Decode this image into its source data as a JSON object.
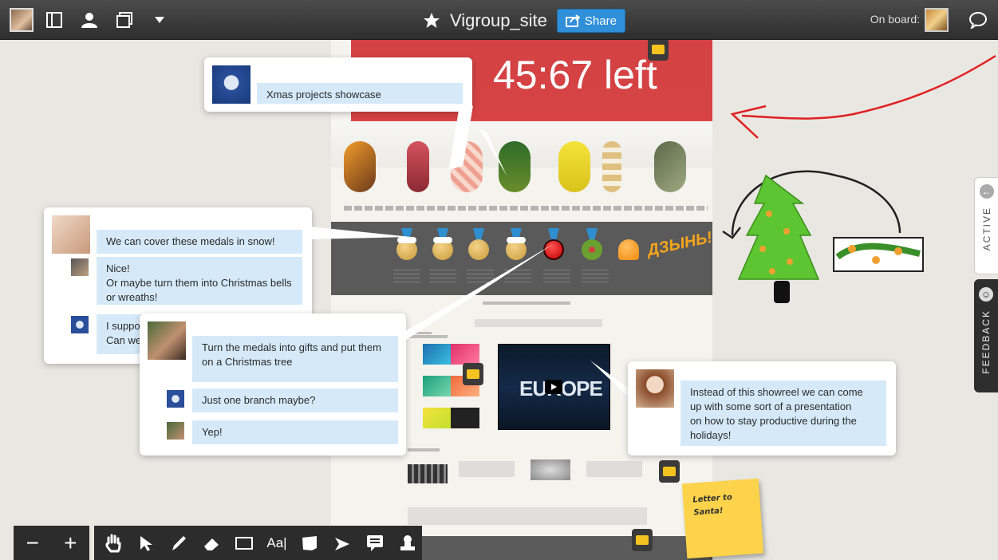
{
  "topbar": {
    "board_title": "Vigroup_site",
    "share_label": "Share",
    "on_board_label": "On board:"
  },
  "board": {
    "timer_text": "45:67 left",
    "sticky_note": "Letter to Santa!",
    "doodle_text": "ДЗЫНЬ!"
  },
  "site": {
    "video_title": "EUROPE"
  },
  "threads": [
    {
      "messages": [
        {
          "text": "Xmas projects showcase"
        }
      ]
    },
    {
      "messages": [
        {
          "text": "We can cover these medals in snow!"
        },
        {
          "text": "Nice!\nOr maybe turn them into Christmas bells or wreaths!"
        },
        {
          "text": "I suppo\nCan we"
        }
      ]
    },
    {
      "messages": [
        {
          "text": "Turn the medals into gifts and put them on a Christmas tree"
        },
        {
          "text": "Just one branch maybe?"
        },
        {
          "text": "Yep!"
        }
      ]
    },
    {
      "messages": [
        {
          "text": "Instead of this showreel we can come up with some sort of a presentation\non how to stay productive during the holidays!"
        }
      ]
    }
  ],
  "side_tabs": {
    "active_label": "ACTIVE",
    "feedback_label": "FEEDBACK"
  },
  "toolbar": {
    "zoom_out": "−",
    "zoom_in": "+",
    "text_tool": "Aa|"
  },
  "colors": {
    "accent_blue": "#2f8fd8",
    "timer_red": "#d73737",
    "bubble_blue": "#d5e9f9",
    "sticky_yellow": "#fcd34a",
    "tree_green": "#5cc531",
    "drawing_red": "#e02020"
  }
}
